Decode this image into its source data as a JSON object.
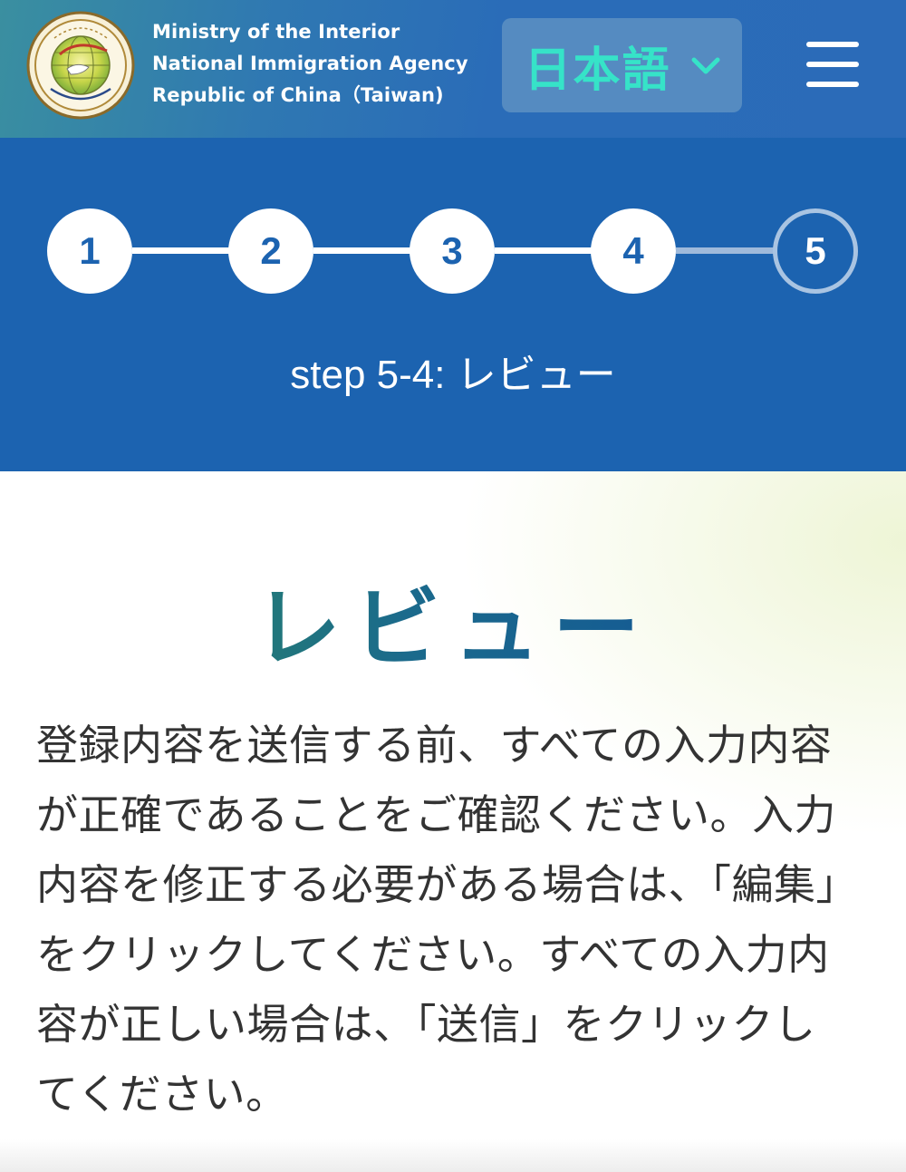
{
  "header": {
    "agency_lines": [
      "Ministry of the Interior",
      "National Immigration Agency",
      "Republic of China（Taiwan)"
    ],
    "logo_icon": "national-immigration-agency-emblem",
    "language_selected": "日本語",
    "language_chevron_icon": "chevron-down-icon",
    "menu_icon": "hamburger-menu-icon"
  },
  "colors": {
    "header_bg": "#2b6bb8",
    "steps_bg": "#1c63b0",
    "language_text": "#36e3c8",
    "step_line_done": "#ffffff",
    "step_line_pending": "#9fbadb",
    "body_text": "#333333"
  },
  "steps": {
    "items": [
      "1",
      "2",
      "3",
      "4",
      "5"
    ],
    "current_index": 5,
    "caption": "step 5-4: レビュー"
  },
  "content": {
    "title": "レビュー",
    "body_lines": [
      "登録内容を送信する前、すべての入力内容",
      "が正確であることをご確認ください。入力",
      "内容を修正する必要がある場合は、「編集」",
      "をクリックしてください。すべての入力内",
      "容が正しい場合は、「送信」をクリックし",
      "てください。"
    ]
  }
}
